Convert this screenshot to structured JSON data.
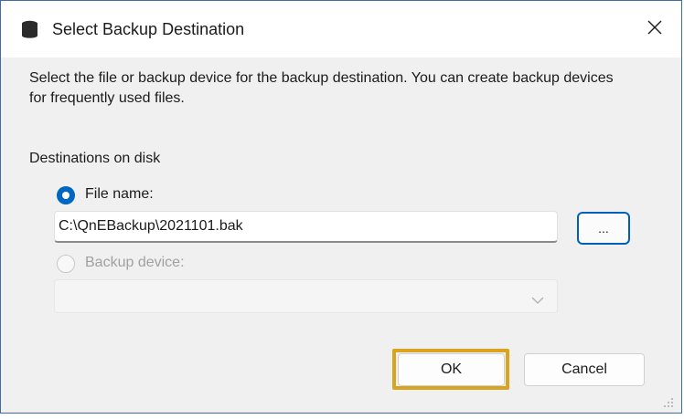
{
  "dialog": {
    "title": "Select Backup Destination",
    "title_icon": "database-icon",
    "close_icon": "close-icon",
    "description": "Select the file or backup device for the backup destination. You can create backup devices for frequently used files."
  },
  "destinations": {
    "group_label": "Destinations on disk",
    "file_option": {
      "label": "File name:",
      "checked": true,
      "value": "C:\\QnEBackup\\2021101.bak"
    },
    "browse_label": "...",
    "device_option": {
      "label": "Backup device:",
      "checked": false,
      "enabled": false,
      "selected": ""
    }
  },
  "buttons": {
    "ok_label": "OK",
    "cancel_label": "Cancel"
  },
  "colors": {
    "accent": "#0067c0",
    "highlight": "#d9a520"
  }
}
